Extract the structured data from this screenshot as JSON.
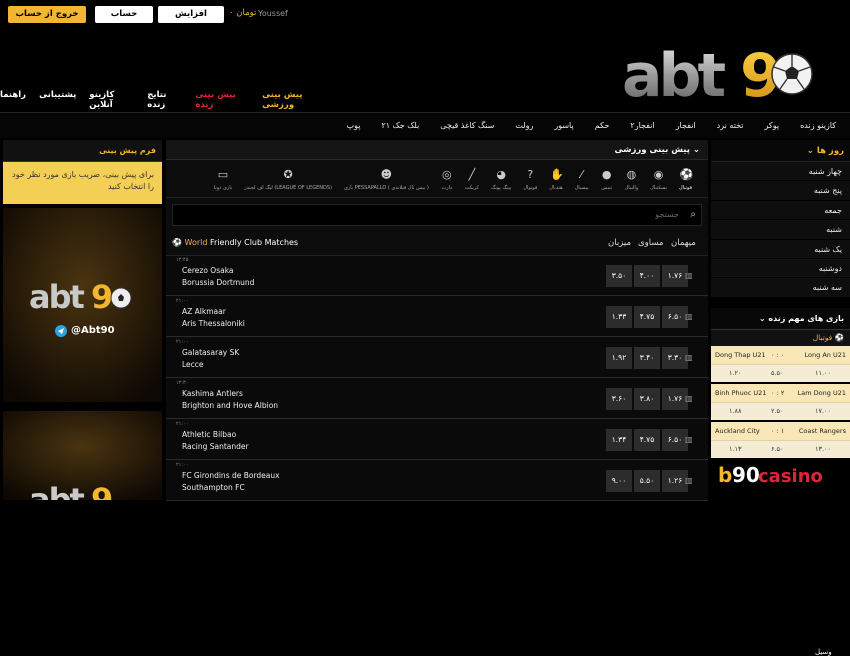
{
  "header": {
    "logout_btn": "خروج از حساب کاربری",
    "account_btn": "حساب کاربری",
    "deposit_btn": "افزایش موجودی",
    "currency": "تومان ۰",
    "username": "Youssef",
    "logo_text": "abt90"
  },
  "main_nav": [
    {
      "label": "پیش بینی ورزشی",
      "active": false
    },
    {
      "label": "پیش بینی زنده",
      "active": true
    },
    {
      "label": "نتایج زنده",
      "active": false
    },
    {
      "label": "کازینو آنلاین",
      "active": false
    },
    {
      "label": "پشتیبانی",
      "active": false
    },
    {
      "label": "راهنما",
      "active": false
    }
  ],
  "sub_nav": [
    "کازینو زنده",
    "پوکر",
    "تخته نرد",
    "انفجار",
    "انفجار۲",
    "حکم",
    "پاسور",
    "رولت",
    "سنگ کاغذ قیچی",
    "بلک جک ۲۱",
    "پوپ"
  ],
  "left": {
    "form_title": "فرم پیش بینی",
    "form_message": "برای پیش بینی، ضریب بازی مورد نظر خود را انتخاب کنید",
    "ad_handle": "@Abt90",
    "ad_logo": "abt90"
  },
  "center": {
    "title": "پیش بینی ورزشی",
    "sports": [
      {
        "label": "فوتبال",
        "icon": "soccer-icon",
        "active": true
      },
      {
        "label": "بسکتبال",
        "icon": "basketball-icon"
      },
      {
        "label": "والیبال",
        "icon": "volleyball-icon"
      },
      {
        "label": "تنیس",
        "icon": "tennis-icon"
      },
      {
        "label": "بیسبال",
        "icon": "baseball-icon"
      },
      {
        "label": "هندبال",
        "icon": "handball-icon"
      },
      {
        "label": "فوتوال",
        "icon": "futsal-icon"
      },
      {
        "label": "پینگ پونگ",
        "icon": "pingpong-icon"
      },
      {
        "label": "کریکت",
        "icon": "cricket-icon"
      },
      {
        "label": "دارت",
        "icon": "darts-icon"
      },
      {
        "label": "بازی PESSAPALLO ( بیس بال فنلاندی )",
        "icon": "pesapallo-icon"
      },
      {
        "label": "لیگ اف لجندز (LEAGUE OF LEGENDS)",
        "icon": "lol-icon"
      },
      {
        "label": "بازی دوتا",
        "icon": "dota-icon"
      }
    ],
    "search_placeholder": "جستجو",
    "league": {
      "prefix": "World",
      "name": "Friendly Club Matches"
    },
    "col_home": "میزبان",
    "col_draw": "مساوی",
    "col_away": "میهمان",
    "matches": [
      {
        "time": "۱۳:۴۵",
        "home": "Cerezo Osaka",
        "away": "Borussia Dortmund",
        "odds": [
          "۳.۵۰",
          "۴.۰۰",
          "۱.۷۶"
        ]
      },
      {
        "time": "۲۱:۰۰",
        "home": "AZ Alkmaar",
        "away": "Aris Thessaloniki",
        "odds": [
          "۱.۳۳",
          "۴.۷۵",
          "۶.۵۰"
        ]
      },
      {
        "time": "۲۱:۰۰",
        "home": "Galatasaray SK",
        "away": "Lecce",
        "odds": [
          "۱.۹۲",
          "۳.۴۰",
          "۳.۳۰"
        ]
      },
      {
        "time": "۱۳:۳۰",
        "home": "Kashima Antlers",
        "away": "Brighton and Hove Albion",
        "odds": [
          "۳.۶۰",
          "۳.۸۰",
          "۱.۷۶"
        ]
      },
      {
        "time": "۲۱:۰۰",
        "home": "Athletic Bilbao",
        "away": "Racing Santander",
        "odds": [
          "۱.۳۴",
          "۴.۷۵",
          "۶.۵۰"
        ]
      },
      {
        "time": "۲۱:۰۰",
        "home": "FC Girondins de Bordeaux",
        "away": "Southampton FC",
        "odds": [
          "۹.۰۰",
          "۵.۵۰",
          "۱.۲۶"
        ]
      }
    ]
  },
  "right": {
    "days_title": "روز ها",
    "days": [
      "چهار شنبه",
      "پنج شنبه",
      "جمعه",
      "شنبه",
      "یک شنبه",
      "دوشنبه",
      "سه شنبه"
    ],
    "live_title": "بازی های مهم زنده",
    "live_sport": "فوتبال",
    "live_matches": [
      {
        "a": "Dong Thap U21",
        "score": "۰ : ۰",
        "b": "Long An U21",
        "odds": [
          "۱.۲۰",
          "۵.۵۰",
          "۱۱.۰۰"
        ]
      },
      {
        "a": "Binh Phuoc U21",
        "score": "۰ : ۲",
        "b": "Lam Dong U21",
        "odds": [
          "۱.۸۸",
          "۲.۵۰",
          "۱۷.۰۰"
        ]
      },
      {
        "a": "Auckland City",
        "score": "۰ : ۱",
        "b": "Coast Rangers",
        "odds": [
          "۱.۱۳",
          "۶.۵۰",
          "۱۳.۰۰"
        ]
      }
    ],
    "live_next": "وسیل",
    "b90_brand": "b90casino"
  },
  "colors": {
    "accent": "#f2b630",
    "active_nav": "#e0233b"
  }
}
